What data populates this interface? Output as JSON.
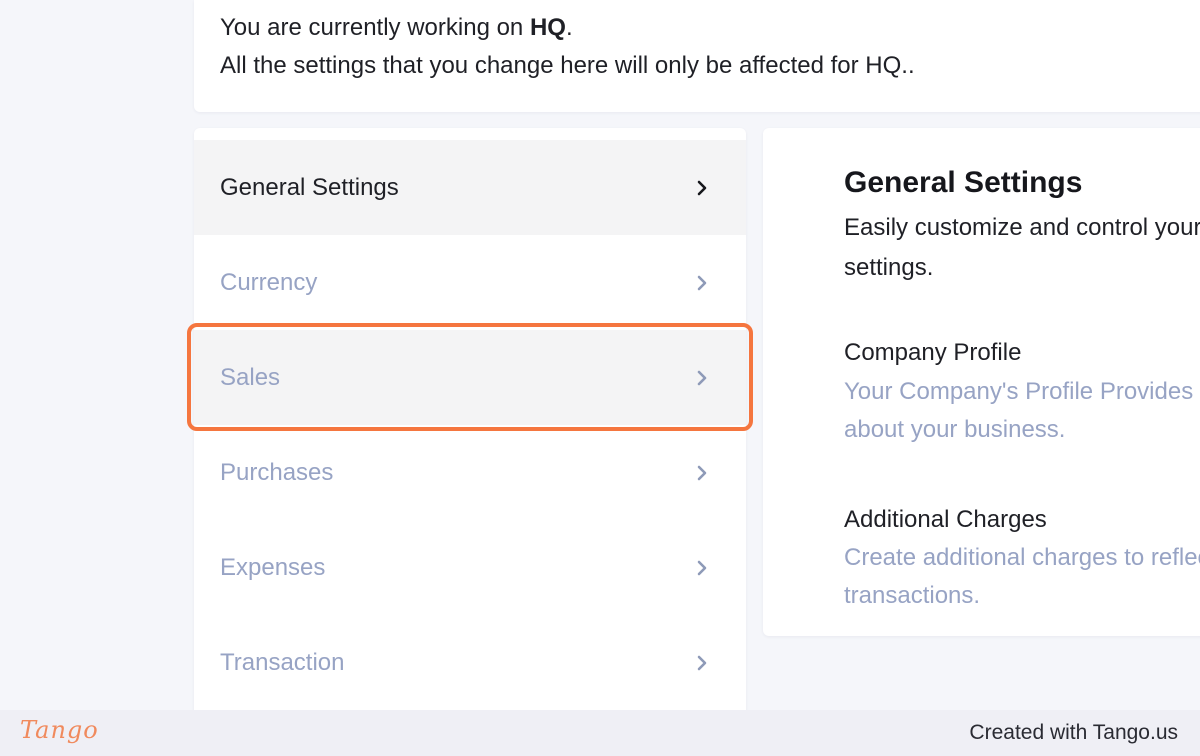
{
  "notice": {
    "line1_prefix": "You are currently working on ",
    "line1_branch": "HQ",
    "line1_suffix": ".",
    "line2": "All the settings that you change here will only be affected for HQ.."
  },
  "menu": {
    "items": [
      {
        "label": "General Settings",
        "state": "active"
      },
      {
        "label": "Currency",
        "state": "default"
      },
      {
        "label": "Sales",
        "state": "hovered"
      },
      {
        "label": "Purchases",
        "state": "default"
      },
      {
        "label": "Expenses",
        "state": "default"
      },
      {
        "label": "Transaction",
        "state": "default"
      }
    ],
    "chevron_icon": "chevron-right-icon"
  },
  "content": {
    "title": "General Settings",
    "description": "Easily customize and control your profile and tax settings.",
    "sections": [
      {
        "title": "Company Profile",
        "description": "Your Company's Profile Provides information about your business."
      },
      {
        "title": "Additional Charges",
        "description": "Create additional charges to reflect on your transactions."
      }
    ]
  },
  "footer": {
    "logo": "Tango",
    "credit": "Created with Tango.us"
  },
  "colors": {
    "highlight": "#f5763f",
    "muted_text": "#97a3c4",
    "active_bg": "#f4f4f5",
    "page_bg": "#f5f6fa"
  }
}
